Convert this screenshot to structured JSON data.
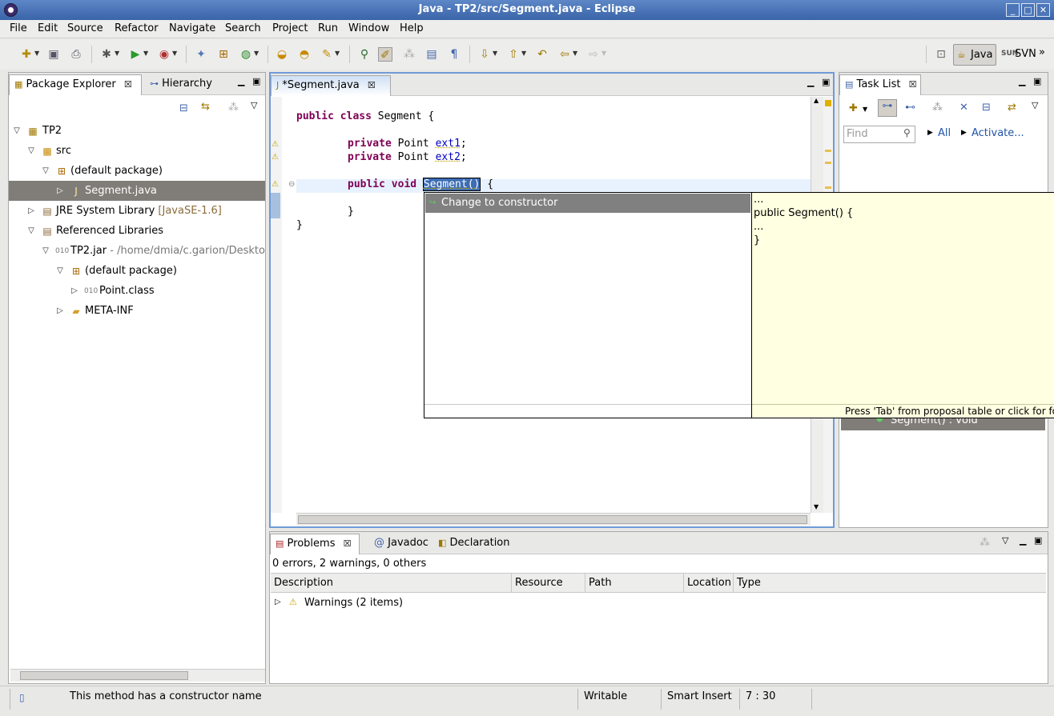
{
  "window": {
    "title": "Java - TP2/src/Segment.java - Eclipse",
    "btn_minimize": "_",
    "btn_maximize": "□",
    "btn_close": "✕"
  },
  "menu": [
    "File",
    "Edit",
    "Source",
    "Refactor",
    "Navigate",
    "Search",
    "Project",
    "Run",
    "Window",
    "Help"
  ],
  "perspectives": {
    "java": "Java",
    "svn": "SVN",
    "more": "»"
  },
  "package_explorer": {
    "tab_label": "Package Explorer",
    "hierarchy_tab": "Hierarchy",
    "tree": [
      {
        "label": "TP2"
      },
      {
        "label": "src"
      },
      {
        "label": "(default package)"
      },
      {
        "label": "Segment.java"
      },
      {
        "label": "JRE System Library",
        "suffix": "[JavaSE-1.6]"
      },
      {
        "label": "Referenced Libraries"
      },
      {
        "label": "TP2.jar",
        "suffix": "- /home/dmia/c.garion/Desktop"
      },
      {
        "label": "(default package)"
      },
      {
        "label": "Point.class"
      },
      {
        "label": "META-INF"
      }
    ]
  },
  "editor": {
    "tab_label": "*Segment.java",
    "lines": {
      "l1_kw": "public class",
      "l1_rest": " Segment {",
      "l2_kw": "private",
      "l2_type": " Point ",
      "l2_fld": "ext1",
      "l2_end": ";",
      "l3_kw": "private",
      "l3_type": " Point ",
      "l3_fld": "ext2",
      "l3_end": ";",
      "l4_kw": "public void",
      "l4_sel": "Segment()",
      "l4_end": " {",
      "l5": "}",
      "l6": "}"
    }
  },
  "completion": {
    "proposal": "Change to constructor",
    "info_lines": [
      "...",
      "public Segment() {",
      "...",
      "}"
    ],
    "footer": "Press 'Tab' from proposal table or click for focus"
  },
  "task_list": {
    "tab_label": "Task List",
    "find_placeholder": "Find",
    "all_link": "All",
    "activate_link": "Activate...",
    "outline_item": "Segment() : void"
  },
  "bottom_panel": {
    "tabs": [
      "Problems",
      "Javadoc",
      "Declaration"
    ],
    "summary": "0 errors, 2 warnings, 0 others",
    "columns": [
      "Description",
      "Resource",
      "Path",
      "Location",
      "Type"
    ],
    "rows": [
      {
        "description": "Warnings (2 items)"
      }
    ]
  },
  "status_bar": {
    "message": "This method has a constructor name",
    "writable": "Writable",
    "insert_mode": "Smart Insert",
    "position": "7 : 30"
  }
}
